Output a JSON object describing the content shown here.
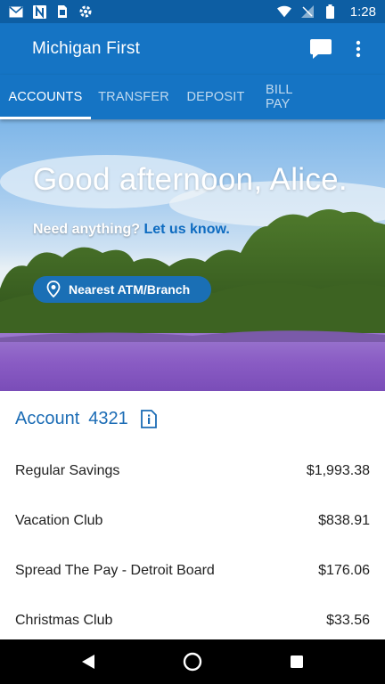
{
  "status_bar": {
    "time": "1:28",
    "left_icons": [
      "gmail-icon",
      "n-icon",
      "sim-icon",
      "settings-notification-icon"
    ],
    "right_icons": [
      "wifi-icon",
      "no-sim-icon",
      "battery-icon"
    ]
  },
  "app_bar": {
    "title": "Michigan First",
    "actions": [
      "chat-icon",
      "more-vert-icon"
    ]
  },
  "tabs": [
    {
      "label": "ACCOUNTS",
      "active": true
    },
    {
      "label": "TRANSFER",
      "active": false
    },
    {
      "label": "DEPOSIT",
      "active": false
    },
    {
      "label": "BILL PAY",
      "active": false
    }
  ],
  "hero": {
    "greeting": "Good afternoon, Alice.",
    "question": "Need anything?",
    "link": "Let us know.",
    "atm_button": "Nearest ATM/Branch"
  },
  "account": {
    "label": "Account",
    "number": "4321",
    "rows": [
      {
        "name": "Regular Savings",
        "amount": "$1,993.38"
      },
      {
        "name": "Vacation Club",
        "amount": "$838.91"
      },
      {
        "name": "Spread The Pay - Detroit Board",
        "amount": "$176.06"
      },
      {
        "name": "Christmas Club",
        "amount": "$33.56"
      }
    ]
  },
  "nav_bar": [
    "back-icon",
    "home-icon",
    "recents-icon"
  ],
  "colors": {
    "primary": "#1574c4",
    "status_bar": "#0d5ea3",
    "account_text": "#1b6cb5",
    "link": "#0d6bc0",
    "lavender": "#8a5cc4"
  }
}
